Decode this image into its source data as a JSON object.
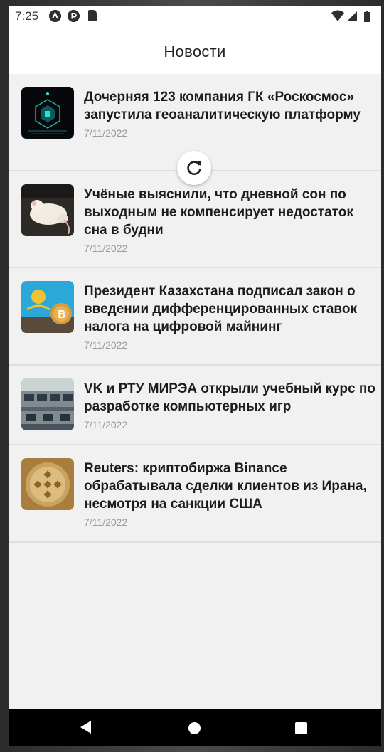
{
  "status_bar": {
    "time": "7:25",
    "icons": [
      "app-a-icon",
      "app-p-icon",
      "sd-card-icon",
      "wifi-icon",
      "signal-icon",
      "battery-icon"
    ]
  },
  "app_bar": {
    "title": "Новости"
  },
  "news": [
    {
      "title": "Дочерняя 123 компания ГК «Роскосмос» запустила геоаналитическую платформу",
      "date": "7/11/2022",
      "image": "space-tech-image"
    },
    {
      "title": "Учёные выяснили, что дневной сон по выходным не компенсирует недостаток сна в будни",
      "date": "7/11/2022",
      "image": "sleeping-mouse-image"
    },
    {
      "title": "Президент Казахстана подписал закон о введении дифференцированных ставок налога на цифровой майнинг",
      "date": "7/11/2022",
      "image": "kazakhstan-bitcoin-image"
    },
    {
      "title": "VK и РТУ МИРЭА открыли учебный курс по разработке компьютерных игр",
      "date": "7/11/2022",
      "image": "classroom-image"
    },
    {
      "title": "Reuters: криптобиржа Binance обрабатывала сделки клиентов из Ирана, несмотря на санкции США",
      "date": "7/11/2022",
      "image": "binance-coin-image"
    }
  ],
  "colors": {
    "background": "#f1f1f1",
    "title_text": "#1c1c1c",
    "date_text": "#9a9a9a",
    "divider": "#dedede",
    "nav_bar": "#000000"
  }
}
